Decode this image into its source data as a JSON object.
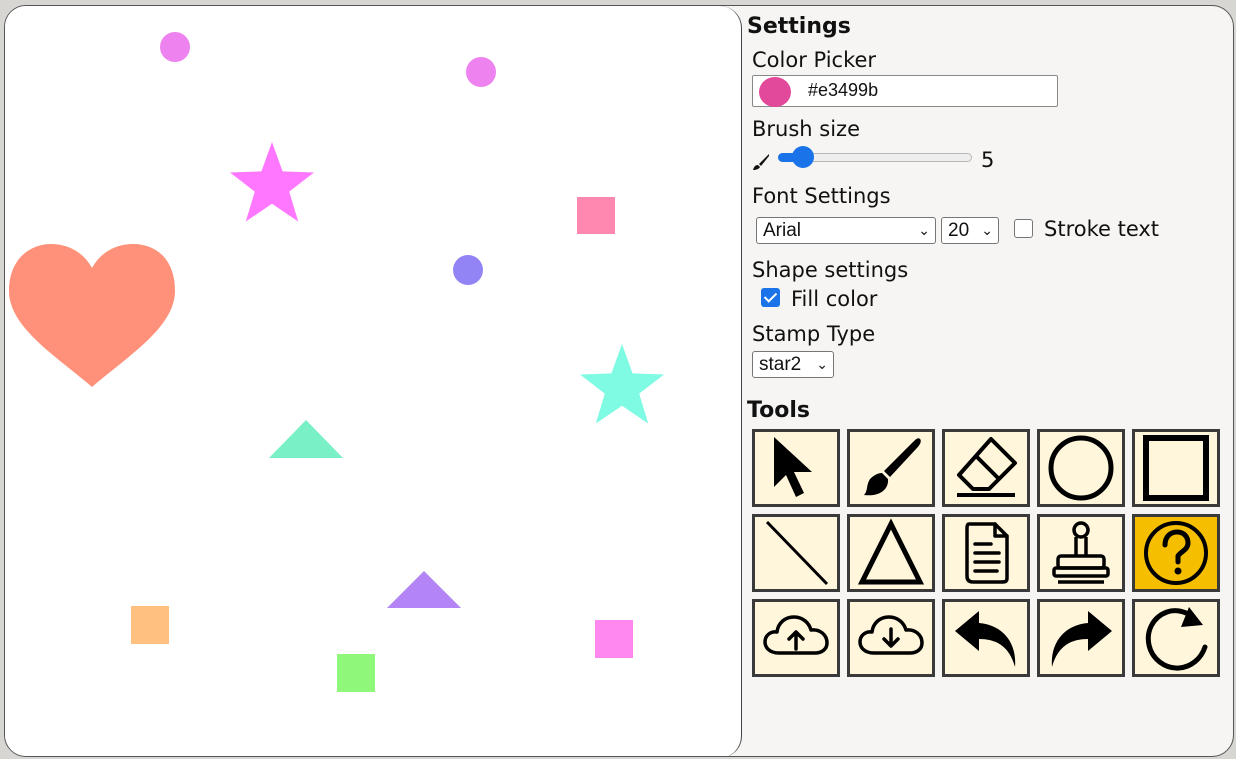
{
  "settings": {
    "heading": "Settings",
    "color_picker_label": "Color Picker",
    "color_value": "#e3499b",
    "brush_size_label": "Brush size",
    "brush_size": 5,
    "brush_min": 1,
    "brush_max": 50,
    "font_settings_label": "Font Settings",
    "font_family": "Arial",
    "font_size": "20",
    "stroke_text_label": "Stroke text",
    "stroke_text_checked": false,
    "shape_settings_label": "Shape settings",
    "fill_color_label": "Fill color",
    "fill_color_checked": true,
    "stamp_type_label": "Stamp Type",
    "stamp_type": "star2"
  },
  "tools": {
    "heading": "Tools",
    "items": [
      {
        "name": "select-tool",
        "icon": "cursor-arrow-icon",
        "active": false
      },
      {
        "name": "brush-tool",
        "icon": "paintbrush-icon",
        "active": false
      },
      {
        "name": "eraser-tool",
        "icon": "eraser-icon",
        "active": false
      },
      {
        "name": "circle-tool",
        "icon": "circle-icon",
        "active": false
      },
      {
        "name": "rectangle-tool",
        "icon": "square-icon",
        "active": false
      },
      {
        "name": "line-tool",
        "icon": "line-icon",
        "active": false
      },
      {
        "name": "triangle-tool",
        "icon": "triangle-icon",
        "active": false
      },
      {
        "name": "text-tool",
        "icon": "document-icon",
        "active": false
      },
      {
        "name": "stamp-tool",
        "icon": "stamp-icon",
        "active": false
      },
      {
        "name": "help-tool",
        "icon": "question-icon",
        "active": true
      },
      {
        "name": "upload-tool",
        "icon": "cloud-upload-icon",
        "active": false
      },
      {
        "name": "download-tool",
        "icon": "cloud-download-icon",
        "active": false
      },
      {
        "name": "undo-tool",
        "icon": "undo-arrow-icon",
        "active": false
      },
      {
        "name": "redo-tool",
        "icon": "redo-arrow-icon",
        "active": false
      },
      {
        "name": "reset-tool",
        "icon": "refresh-icon",
        "active": false
      }
    ]
  },
  "colors": {
    "active_tool": "#f5bf00",
    "tool_bg": "#fff6dc",
    "slider_accent": "#1a73e8"
  },
  "canvas_shapes": [
    {
      "shape": "circle",
      "color": "#ee82ee"
    },
    {
      "shape": "circle",
      "color": "#ee82ee"
    },
    {
      "shape": "star",
      "color": "#ff77ff"
    },
    {
      "shape": "square",
      "color": "#ff88b0"
    },
    {
      "shape": "heart",
      "color": "#ff917a"
    },
    {
      "shape": "circle",
      "color": "#9384f5"
    },
    {
      "shape": "star",
      "color": "#7ffbe4"
    },
    {
      "shape": "triangle",
      "color": "#79f0c6"
    },
    {
      "shape": "triangle",
      "color": "#b384f5"
    },
    {
      "shape": "square",
      "color": "#ffc080"
    },
    {
      "shape": "square",
      "color": "#8ff77a"
    },
    {
      "shape": "square",
      "color": "#ff88ee"
    }
  ]
}
